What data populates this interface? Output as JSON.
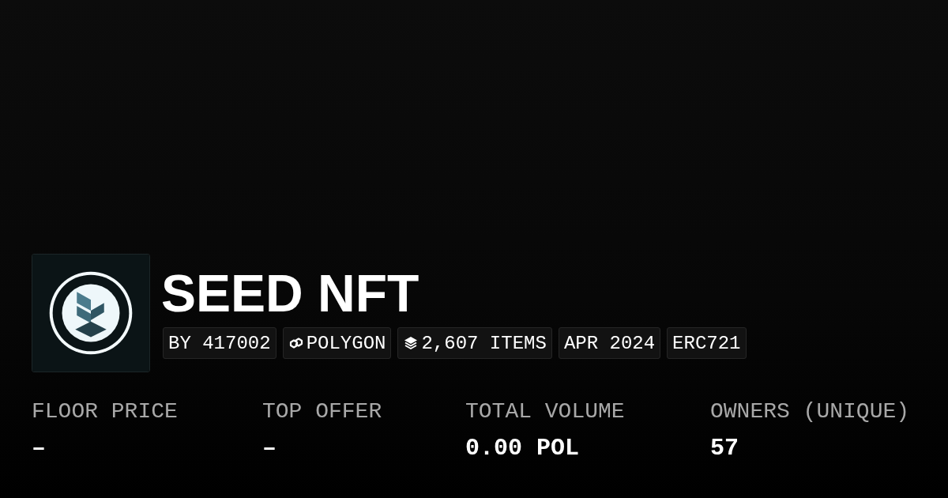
{
  "collection": {
    "title": "SEED NFT",
    "tags": [
      {
        "kind": "text",
        "label": "BY 417002"
      },
      {
        "kind": "chain",
        "label": "POLYGON"
      },
      {
        "kind": "items",
        "label": "2,607 ITEMS"
      },
      {
        "kind": "text",
        "label": "APR 2024"
      },
      {
        "kind": "text",
        "label": "ERC721"
      }
    ]
  },
  "stats": [
    {
      "label": "FLOOR PRICE",
      "value": "–"
    },
    {
      "label": "TOP OFFER",
      "value": "–"
    },
    {
      "label": "TOTAL VOLUME",
      "value": "0.00 POL"
    },
    {
      "label": "OWNERS (UNIQUE)",
      "value": "57"
    }
  ]
}
